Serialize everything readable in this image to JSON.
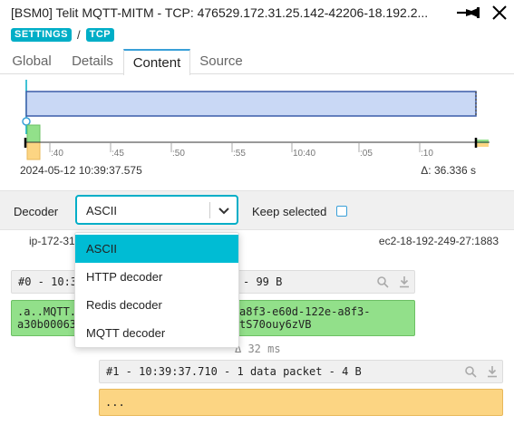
{
  "window": {
    "title": "[BSM0] Telit MQTT-MITM - TCP: 476529.172.31.25.142-42206-18.192.2..."
  },
  "breadcrumb": {
    "items": [
      "SETTINGS",
      "TCP"
    ],
    "separator": "/"
  },
  "tabs": [
    "Global",
    "Details",
    "Content",
    "Source"
  ],
  "active_tab": "Content",
  "timeline": {
    "tick_labels": [
      ":40",
      ":45",
      ":50",
      ":55",
      "10:40",
      ":05",
      ":10"
    ],
    "start_time": "2024-05-12 10:39:37.575",
    "delta": "Δ: 36.336 s"
  },
  "decoder": {
    "label": "Decoder",
    "selected": "ASCII",
    "keep_selected_label": "Keep selected",
    "keep_selected_checked": false,
    "options": [
      "ASCII",
      "HTTP decoder",
      "Redis decoder",
      "MQTT decoder"
    ]
  },
  "hosts": {
    "left": "ip-172-31",
    "right": "ec2-18-192-249-27:1883"
  },
  "packets": [
    {
      "header": "#0 - 10:3",
      "header_suffix": "- 99 B",
      "body_lines_left": [
        ".a..MQTT.",
        "a30b00063"
      ],
      "body_lines_right": [
        "a8f3-e60d-122e-a8f3-",
        "tS70ouy6zVB"
      ],
      "color": "#92e08a"
    },
    {
      "header": "#1 - 10:39:37.710 - 1 data packet - 4 B",
      "body": "...",
      "color": "#fcd583"
    }
  ],
  "gap_label": "Δ 32 ms",
  "colors": {
    "accent": "#00aec7",
    "selection": "#00bcd4",
    "client_packet": "#92e08a",
    "server_packet": "#fcd583",
    "timeline_range": "#c9d8f5"
  }
}
